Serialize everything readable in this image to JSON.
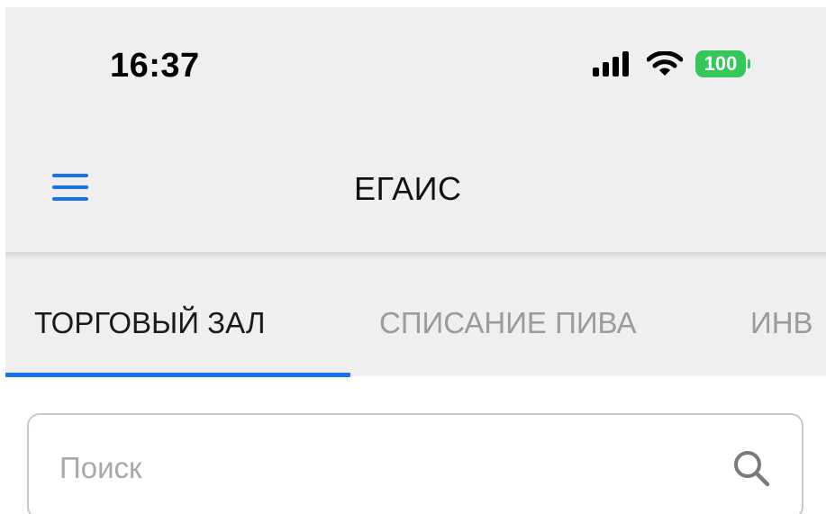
{
  "status_bar": {
    "time": "16:37",
    "battery": "100",
    "battery_color": "#34c759"
  },
  "app_bar": {
    "title": "ЕГАИС",
    "menu_icon": "hamburger-menu-icon",
    "accent": "#1a73e8"
  },
  "tabs": [
    {
      "label": "ТОРГОВЫЙ ЗАЛ",
      "active": true
    },
    {
      "label": "СПИСАНИЕ ПИВА",
      "active": false
    },
    {
      "label": "ИНВ",
      "active": false
    }
  ],
  "search": {
    "placeholder": "Поиск",
    "value": "",
    "icon": "search-icon"
  }
}
